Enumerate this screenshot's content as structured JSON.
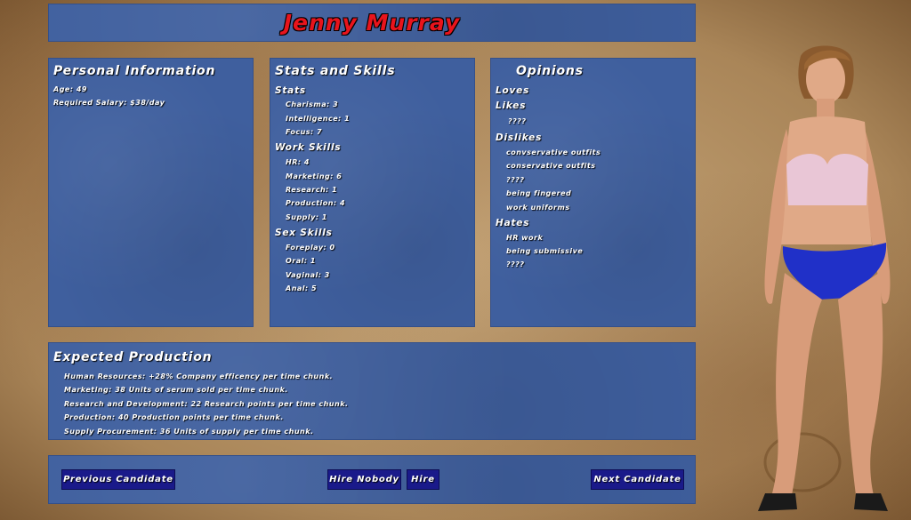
{
  "candidate": {
    "name": "Jenny Murray"
  },
  "personal": {
    "title": "Personal Information",
    "lines": [
      "Age: 49",
      "Required Salary: $38/day"
    ]
  },
  "stats": {
    "title": "Stats and Skills",
    "sections": [
      {
        "label": "Stats",
        "items": [
          "Charisma: 3",
          "Intelligence: 1",
          "Focus: 7"
        ]
      },
      {
        "label": "Work Skills",
        "items": [
          "HR: 4",
          "Marketing: 6",
          "Research: 1",
          "Production: 4",
          "Supply: 1"
        ]
      },
      {
        "label": "Sex Skills",
        "items": [
          "Foreplay: 0",
          "Oral: 1",
          "Vaginal: 3",
          "Anal: 5"
        ]
      }
    ]
  },
  "opinions": {
    "title": "Opinions",
    "sections": [
      {
        "label": "Loves",
        "items": []
      },
      {
        "label": "Likes",
        "items": [
          "????"
        ]
      },
      {
        "label": "Dislikes",
        "items": [
          "convservative outfits",
          "conservative outfits",
          "????",
          "being fingered",
          "work uniforms"
        ]
      },
      {
        "label": "Hates",
        "items": [
          "HR work",
          "being submissive",
          "????"
        ]
      }
    ]
  },
  "production": {
    "title": "Expected Production",
    "lines": [
      "Human Resources: +28% Company efficency per time chunk.",
      "Marketing: 38 Units of serum sold per time chunk.",
      "Research and Development: 22 Research points per time chunk.",
      "Production: 40 Production points per time chunk.",
      "Supply Procurement: 36 Units of supply per time chunk."
    ]
  },
  "buttons": {
    "previous": "Previous Candidate",
    "hire_nobody": "Hire Nobody",
    "hire": "Hire",
    "next": "Next Candidate"
  },
  "colors": {
    "panel": "#3f5f9e",
    "button": "#1a1a8a",
    "name": "#e8141c"
  }
}
